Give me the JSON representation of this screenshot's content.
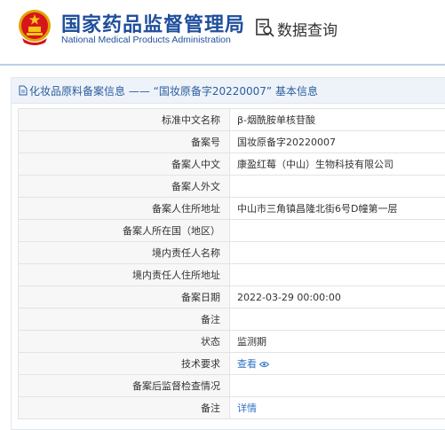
{
  "header": {
    "title_cn": "国家药品监督管理局",
    "title_en": "National Medical Products Administration",
    "query_label": "数据查询",
    "emblem_icon": "national-emblem",
    "query_icon": "data-query-icon"
  },
  "panel": {
    "title": "化妆品原料备案信息 —— “国妆原备字20220007” 基本信息",
    "title_icon": "document-icon"
  },
  "rows": [
    {
      "label": "标准中文名称",
      "value": "β-烟酰胺单核苷酸"
    },
    {
      "label": "备案号",
      "value": "国妆原备字20220007"
    },
    {
      "label": "备案人中文",
      "value": "康盈红莓（中山）生物科技有限公司"
    },
    {
      "label": "备案人外文",
      "value": ""
    },
    {
      "label": "备案人住所地址",
      "value": "中山市三角镇昌隆北街6号D幢第一层"
    },
    {
      "label": "备案人所在国（地区）",
      "value": ""
    },
    {
      "label": "境内责任人名称",
      "value": ""
    },
    {
      "label": "境内责任人住所地址",
      "value": ""
    },
    {
      "label": "备案日期",
      "value": "2022-03-29 00:00:00"
    },
    {
      "label": "备注",
      "value": ""
    },
    {
      "label": "状态",
      "value": "监测期"
    },
    {
      "label": "技术要求",
      "value": "查看",
      "link": true,
      "icon": "eye-icon"
    },
    {
      "label": "备案后监督检查情况",
      "value": ""
    },
    {
      "label": "备注",
      "value": "详情",
      "link": true
    }
  ],
  "colors": {
    "brand_blue": "#1f4f9c",
    "link_blue": "#2f73c7",
    "emblem_red": "#d7151b",
    "emblem_gold": "#f5c518"
  }
}
